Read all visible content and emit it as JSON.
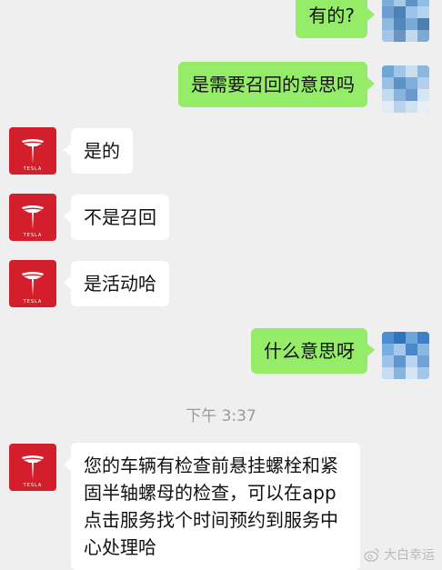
{
  "chat": {
    "messages": [
      {
        "side": "out",
        "text": "有的?"
      },
      {
        "side": "out",
        "text": "是需要召回的意思吗"
      },
      {
        "side": "in",
        "text": "是的"
      },
      {
        "side": "in",
        "text": "不是召回"
      },
      {
        "side": "in",
        "text": "是活动哈"
      },
      {
        "side": "out",
        "text": "什么意思呀"
      },
      {
        "side": "in",
        "text": "您的车辆有检查前悬挂螺栓和紧固半轴螺母的检查，可以在app点击服务找个时间预约到服务中心处理哈"
      }
    ],
    "timestamp": "下午 3:37",
    "avatar_label": "TESLA"
  },
  "watermark": {
    "text": "大白幸运"
  },
  "colors": {
    "background": "#efefef",
    "outgoing_bubble": "#95ec69",
    "incoming_bubble": "#ffffff",
    "tesla_red": "#d21f2b"
  },
  "icons": {
    "tesla_avatar": "tesla-logo-icon",
    "user_avatar": "pixelated-avatar-icon",
    "watermark": "weibo-icon"
  }
}
